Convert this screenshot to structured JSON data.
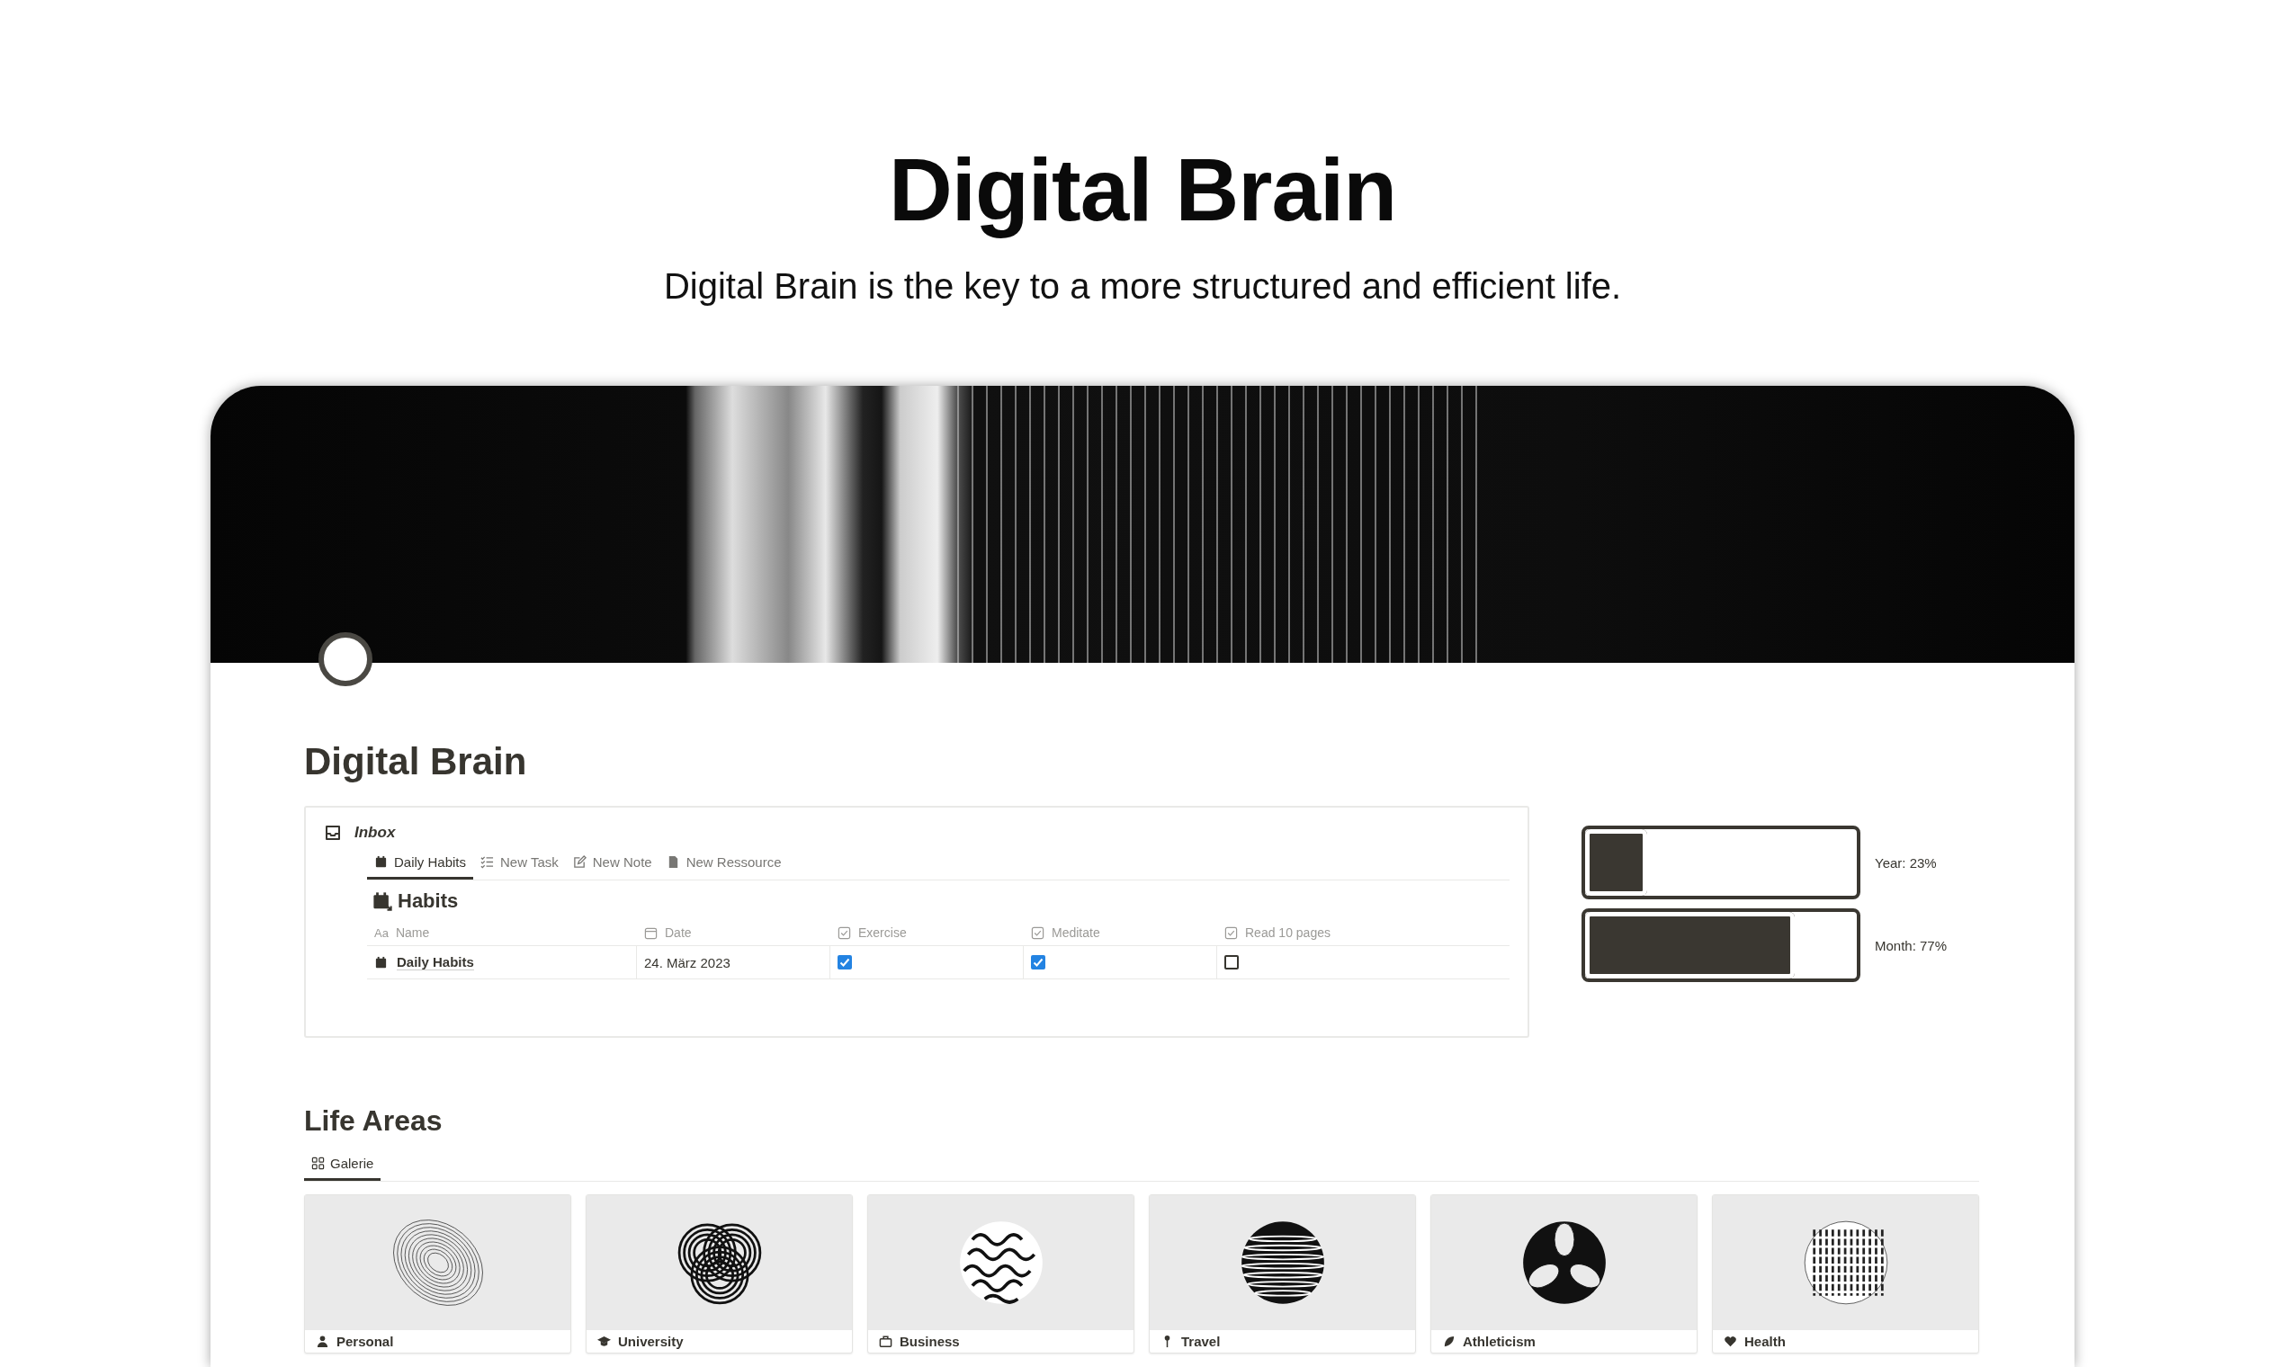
{
  "header": {
    "title": "Digital Brain",
    "subtitle": "Digital Brain is the key to a more structured and efficient life."
  },
  "page": {
    "title": "Digital Brain",
    "inbox": {
      "title": "Inbox",
      "tabs": [
        {
          "label": "Daily Habits",
          "selected": true
        },
        {
          "label": "New Task",
          "selected": false
        },
        {
          "label": "New Note",
          "selected": false
        },
        {
          "label": "New Ressource",
          "selected": false
        }
      ],
      "section_title": "Habits",
      "columns": [
        {
          "label": "Name",
          "kind": "title",
          "icon_text": "Aa"
        },
        {
          "label": "Date",
          "kind": "date"
        },
        {
          "label": "Exercise",
          "kind": "checkbox"
        },
        {
          "label": "Meditate",
          "kind": "checkbox"
        },
        {
          "label": "Read 10 pages",
          "kind": "checkbox"
        }
      ],
      "rows": [
        {
          "name": "Daily Habits",
          "date": "24. März 2023",
          "checks": [
            {
              "checked": true
            },
            {
              "checked": true
            },
            {
              "checked": false
            }
          ]
        }
      ]
    },
    "progress": [
      {
        "level": 0.23,
        "label": "Year: 23%"
      },
      {
        "level": 0.77,
        "label": "Month: 77%"
      }
    ],
    "life_areas": {
      "title": "Life Areas",
      "views": [
        {
          "label": "Galerie",
          "selected": true
        }
      ],
      "cards": [
        {
          "title": "Personal"
        },
        {
          "title": "University"
        },
        {
          "title": "Business"
        },
        {
          "title": "Travel"
        },
        {
          "title": "Athleticism"
        },
        {
          "title": "Health"
        }
      ]
    }
  }
}
